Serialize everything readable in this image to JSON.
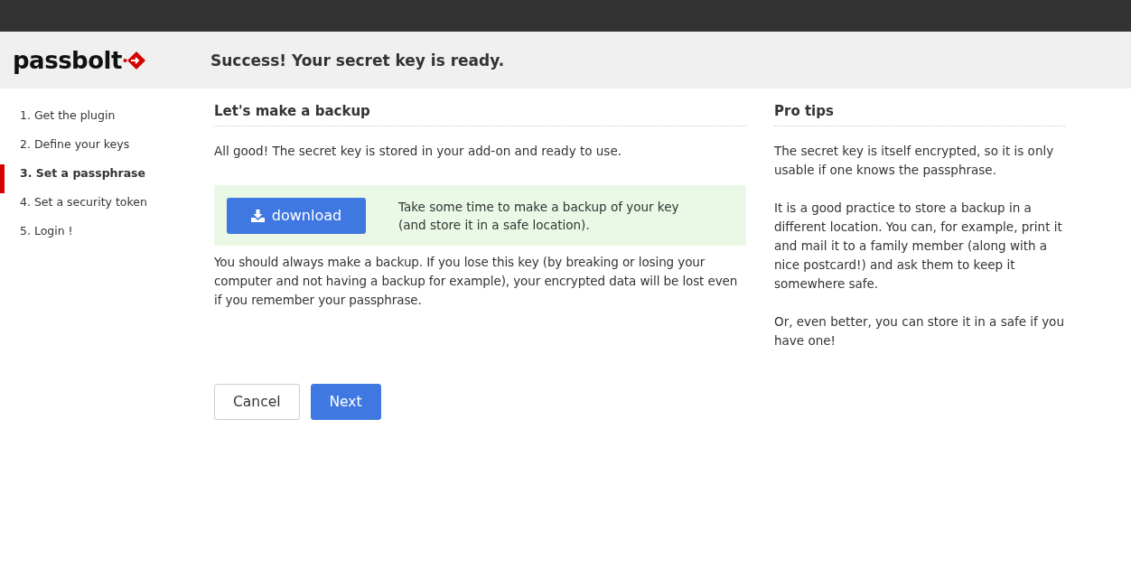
{
  "header": {
    "logo": "passbolt",
    "title": "Success! Your secret key is ready."
  },
  "steps": [
    {
      "label": "1. Get the plugin",
      "selected": false
    },
    {
      "label": "2. Define your keys",
      "selected": false
    },
    {
      "label": "3. Set a passphrase",
      "selected": true
    },
    {
      "label": "4. Set a security token",
      "selected": false
    },
    {
      "label": "5. Login !",
      "selected": false
    }
  ],
  "main": {
    "heading": "Let's make a backup",
    "intro": "All good! The secret key is stored in your add-on and ready to use.",
    "download_button": "download",
    "download_hint": [
      "Take some time to make a backup of your key",
      "(and store it in a safe location)."
    ],
    "warning": "You should always make a backup. If you lose this key (by breaking or losing your computer and not having a backup for example), your encrypted data will be lost even if you remember your passphrase.",
    "buttons": [
      {
        "label": "Cancel",
        "kind": "secondary"
      },
      {
        "label": "Next",
        "kind": "primary"
      }
    ]
  },
  "tips": {
    "heading": "Pro tips",
    "paragraphs": [
      "The secret key is itself encrypted, so it is only usable if one knows the passphrase.",
      "It is a good practice to store a backup in a different location. You can, for example, print it and mail it to a family member (along with a nice postcard!) and ask them to keep it somewhere safe.",
      "Or, even better, you can store it in a safe if you have one!"
    ]
  }
}
